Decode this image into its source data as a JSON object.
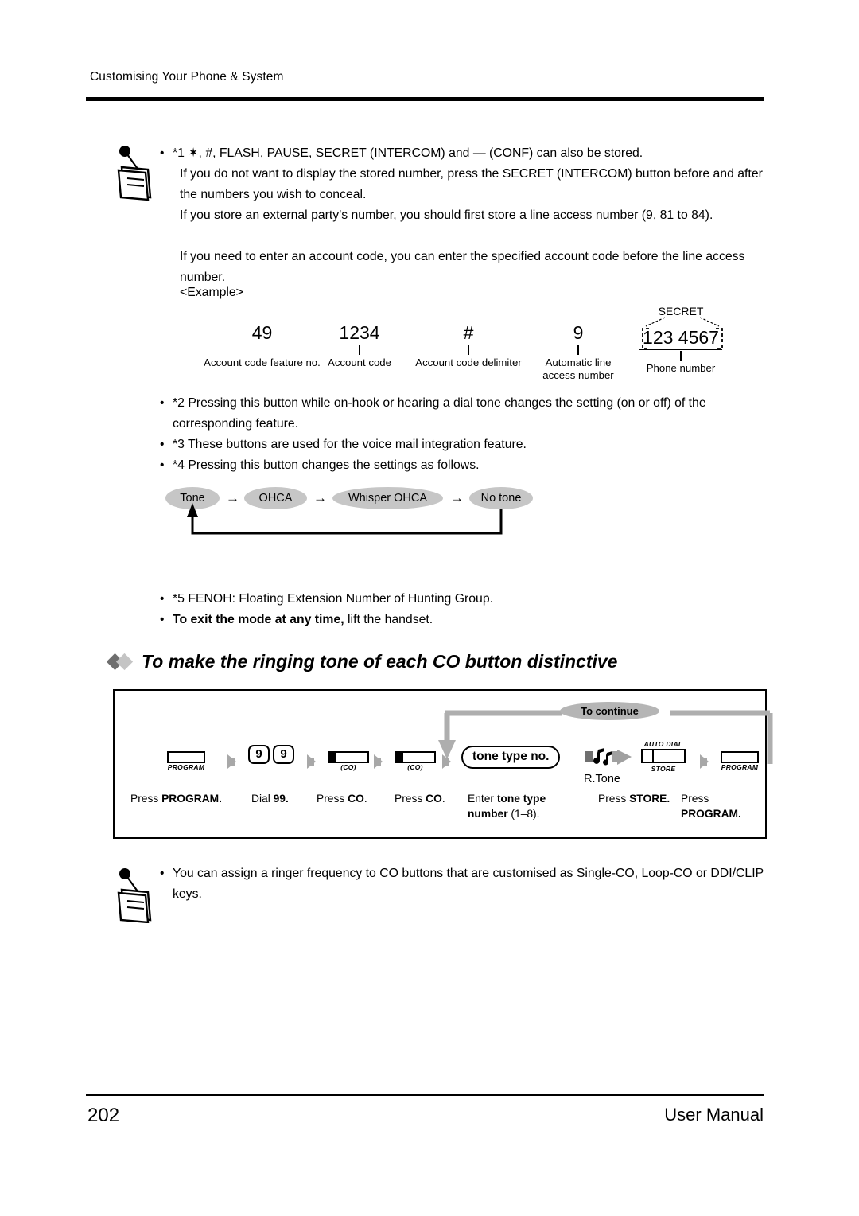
{
  "header": {
    "title": "Customising Your Phone & System"
  },
  "footer": {
    "page_number": "202",
    "manual_label": "User Manual"
  },
  "notes_top": {
    "bullet": "•",
    "line1": "*1 ✶, #, FLASH, PAUSE, SECRET (INTERCOM) and — (CONF) can also be stored.",
    "para1": "If you do not want to display the stored number, press the SECRET (INTERCOM) button before and after the numbers you wish to conceal.",
    "para2": "If you store an external party's number, you should first store a line access number (9, 81 to 84).",
    "para3": "If you need to enter an account code, you can enter the specified account code before the line access number.",
    "example_label": "<Example>"
  },
  "example": {
    "secret_label": "SECRET",
    "items": [
      {
        "value": "49",
        "label": "Account code feature no."
      },
      {
        "value": "1234",
        "label": "Account code"
      },
      {
        "value": "#",
        "label": "Account code delimiter"
      },
      {
        "value": "9",
        "label": "Automatic line\naccess number"
      },
      {
        "value": "123  4567",
        "label": "Phone number"
      }
    ]
  },
  "footnotes": [
    {
      "bullet": "•",
      "text": "*2 Pressing this button while on-hook or hearing a dial tone changes the setting (on or off) of the corresponding feature."
    },
    {
      "bullet": "•",
      "text": "*3 These buttons are used for the voice mail integration feature."
    },
    {
      "bullet": "•",
      "text": "*4 Pressing this button changes the settings as follows."
    }
  ],
  "ohca_flow": {
    "arrow": "→",
    "states": [
      "Tone",
      "OHCA",
      "Whisper OHCA",
      "No tone"
    ]
  },
  "footnotes2": [
    {
      "bullet": "•",
      "text": "*5 FENOH: Floating Extension Number of Hunting Group."
    }
  ],
  "exit_note": {
    "bullet": "•",
    "bold": "To exit the mode at any time,",
    "rest": " lift the handset."
  },
  "section": {
    "heading": "To make the ringing tone of each CO button distinctive"
  },
  "procedure": {
    "continue_label": "To continue",
    "steps": [
      {
        "type": "program-button",
        "caption": "PROGRAM",
        "label_plain": "Press ",
        "label_bold": "PROGRAM."
      },
      {
        "type": "keypad",
        "keys": [
          "9",
          "9"
        ],
        "label_plain": "Dial ",
        "label_bold": "99."
      },
      {
        "type": "co-button",
        "caption": "(CO)",
        "label_plain": "Press ",
        "label_bold": "CO",
        "label_tail": "."
      },
      {
        "type": "co-button",
        "caption": "(CO)",
        "label_plain": "Press ",
        "label_bold": "CO",
        "label_tail": "."
      },
      {
        "type": "tone-pill",
        "text": "tone type no.",
        "label_plain": "Enter ",
        "label_bold": "tone type number",
        "label_tail": " (1–8)."
      },
      {
        "type": "ringtone",
        "caption": "R.Tone"
      },
      {
        "type": "store-button",
        "caption_top": "AUTO DIAL",
        "caption_bottom": "STORE",
        "label_plain": "Press ",
        "label_bold": "STORE."
      },
      {
        "type": "program-button",
        "caption": "PROGRAM",
        "label_plain": "Press ",
        "label_bold": "PROGRAM."
      }
    ]
  },
  "notes_bottom": {
    "bullet": "•",
    "text": "You can assign a ringer frequency to CO buttons that are customised as Single-CO, Loop-CO or DDI/CLIP keys."
  },
  "colors": {
    "oval_gray": "#c6c6c6",
    "arrow_gray": "#a8a8a8",
    "diamond_dark": "#6e6e6e",
    "diamond_light": "#c4c4c4"
  }
}
